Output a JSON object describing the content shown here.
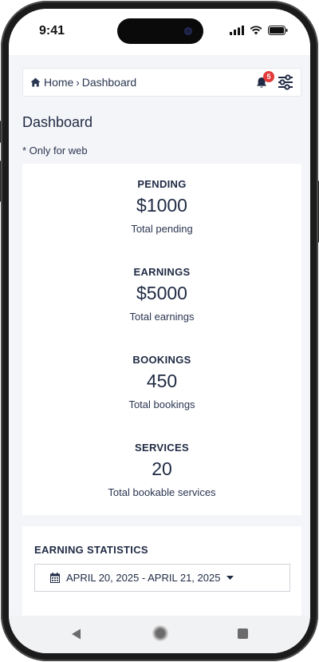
{
  "status_bar": {
    "time": "9:41"
  },
  "breadcrumb": {
    "home": "Home",
    "separator": "›",
    "current": "Dashboard"
  },
  "notifications": {
    "count": "5"
  },
  "page": {
    "title": "Dashboard",
    "note": "* Only for web"
  },
  "stats": [
    {
      "label": "PENDING",
      "value": "$1000",
      "desc": "Total pending"
    },
    {
      "label": "EARNINGS",
      "value": "$5000",
      "desc": "Total earnings"
    },
    {
      "label": "BOOKINGS",
      "value": "450",
      "desc": "Total bookings"
    },
    {
      "label": "SERVICES",
      "value": "20",
      "desc": "Total bookable services"
    }
  ],
  "earning_statistics": {
    "title": "EARNING STATISTICS",
    "date_range": "APRIL 20, 2025 - APRIL 21, 2025"
  },
  "icons": {
    "home": "home-icon",
    "bell": "bell-icon",
    "filter": "sliders-icon",
    "calendar": "calendar-icon",
    "caret": "caret-down-icon",
    "back": "back-icon",
    "nav_home": "home-circle-icon",
    "recents": "recents-icon"
  },
  "colors": {
    "badge": "#e23b3b",
    "text": "#1f2a44",
    "background": "#f4f5f8"
  }
}
